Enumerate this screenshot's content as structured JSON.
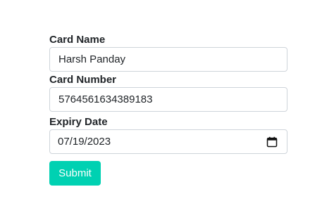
{
  "form": {
    "card_name": {
      "label": "Card Name",
      "value": "Harsh Panday"
    },
    "card_number": {
      "label": "Card Number",
      "value": "5764561634389183"
    },
    "expiry_date": {
      "label": "Expiry Date",
      "value": "07/19/2023",
      "icon": "calendar-icon"
    },
    "submit_label": "Submit"
  },
  "colors": {
    "accent": "#00d1b2",
    "input_border": "#ced4da",
    "text": "#212529"
  }
}
